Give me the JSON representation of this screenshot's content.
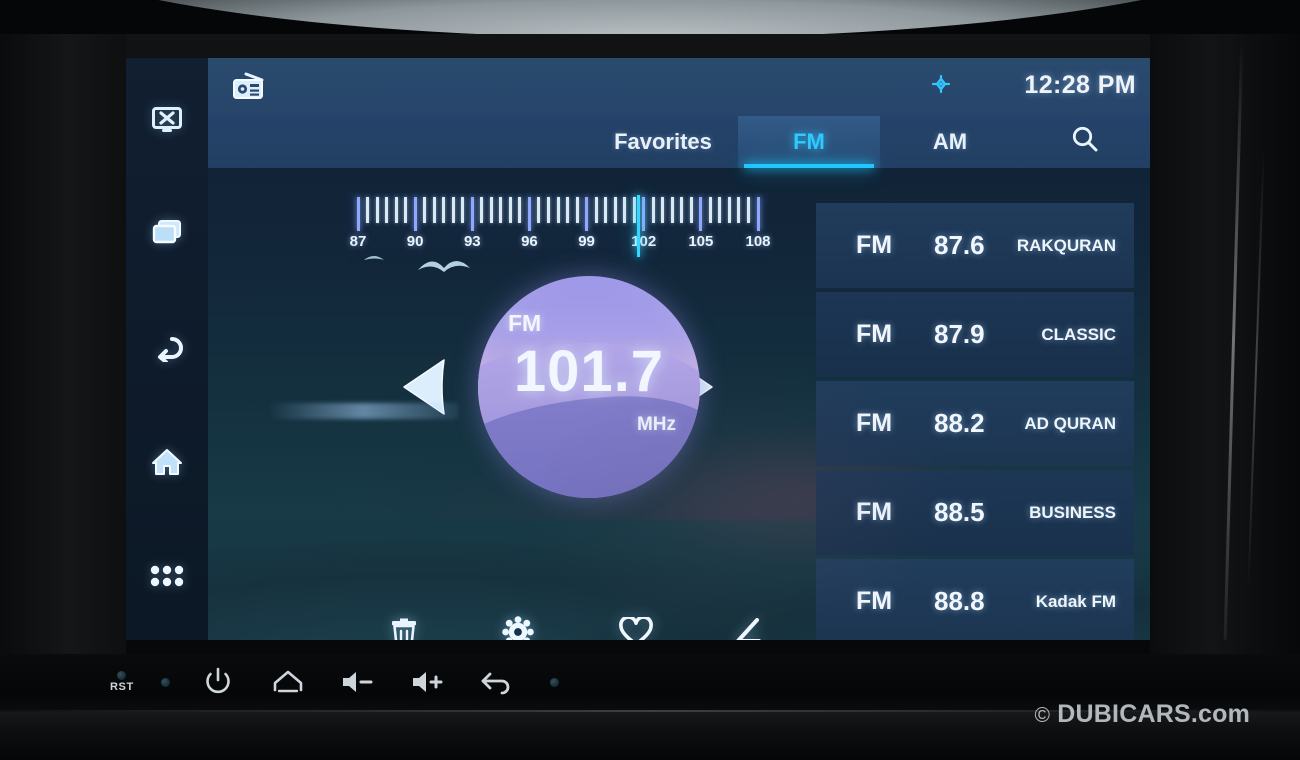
{
  "header": {
    "app_icon": "radio-icon",
    "gps_icon": "gps-location-icon",
    "clock": "12:28 PM"
  },
  "tabs": [
    {
      "label": "Favorites",
      "active": false,
      "name": "tab-favorites"
    },
    {
      "label": "FM",
      "active": true,
      "name": "tab-fm"
    },
    {
      "label": "AM",
      "active": false,
      "name": "tab-am"
    },
    {
      "label": "",
      "active": false,
      "name": "tab-search",
      "icon": "search-icon"
    }
  ],
  "sidebar": {
    "items": [
      {
        "icon": "screen-off-icon",
        "name": "sidebar-item-screen-off"
      },
      {
        "icon": "multi-window-icon",
        "name": "sidebar-item-multi-window"
      },
      {
        "icon": "back-arrow-icon",
        "name": "sidebar-item-back"
      },
      {
        "icon": "home-icon",
        "name": "sidebar-item-home"
      },
      {
        "icon": "app-grid-icon",
        "name": "sidebar-item-apps"
      }
    ]
  },
  "tuner": {
    "scale_labels": [
      "87",
      "90",
      "93",
      "96",
      "99",
      "102",
      "105",
      "108"
    ],
    "scale_min": 87,
    "scale_max": 108,
    "cursor_value": "101.7",
    "band": "FM",
    "frequency": "101.7",
    "unit": "MHz",
    "prev_label": "prev-station",
    "next_label": "next-station"
  },
  "actions": [
    {
      "icon": "trash-icon",
      "name": "delete-button"
    },
    {
      "icon": "gear-icon",
      "name": "settings-button"
    },
    {
      "icon": "heart-icon",
      "name": "favorite-button"
    },
    {
      "icon": "equalizer-icon",
      "name": "equalizer-button"
    }
  ],
  "stations": [
    {
      "band": "FM",
      "frequency": "87.6",
      "name": "RAKQURAN"
    },
    {
      "band": "FM",
      "frequency": "87.9",
      "name": "CLASSIC"
    },
    {
      "band": "FM",
      "frequency": "88.2",
      "name": "AD QURAN"
    },
    {
      "band": "FM",
      "frequency": "88.5",
      "name": "BUSINESS"
    },
    {
      "band": "FM",
      "frequency": "88.8",
      "name": "Kadak FM"
    }
  ],
  "hardware_buttons": [
    {
      "label": "RST",
      "name": "reset-button"
    },
    {
      "label": "",
      "name": "power-button",
      "icon": "power-icon"
    },
    {
      "label": "",
      "name": "home-hardware-button",
      "icon": "home-icon"
    },
    {
      "label": "",
      "name": "volume-down-button",
      "icon": "volume-down-icon"
    },
    {
      "label": "",
      "name": "volume-up-button",
      "icon": "volume-up-icon"
    },
    {
      "label": "",
      "name": "back-hardware-button",
      "icon": "back-icon"
    }
  ],
  "watermark": {
    "symbol": "©",
    "text": "DUBICARS.com"
  },
  "colors": {
    "accent_cyan": "#1fc8ff",
    "header_blue": "#27456a",
    "panel_blue": "#223e5f",
    "dial_purple": "#a79fe8",
    "text_white": "#f0f6fc"
  }
}
